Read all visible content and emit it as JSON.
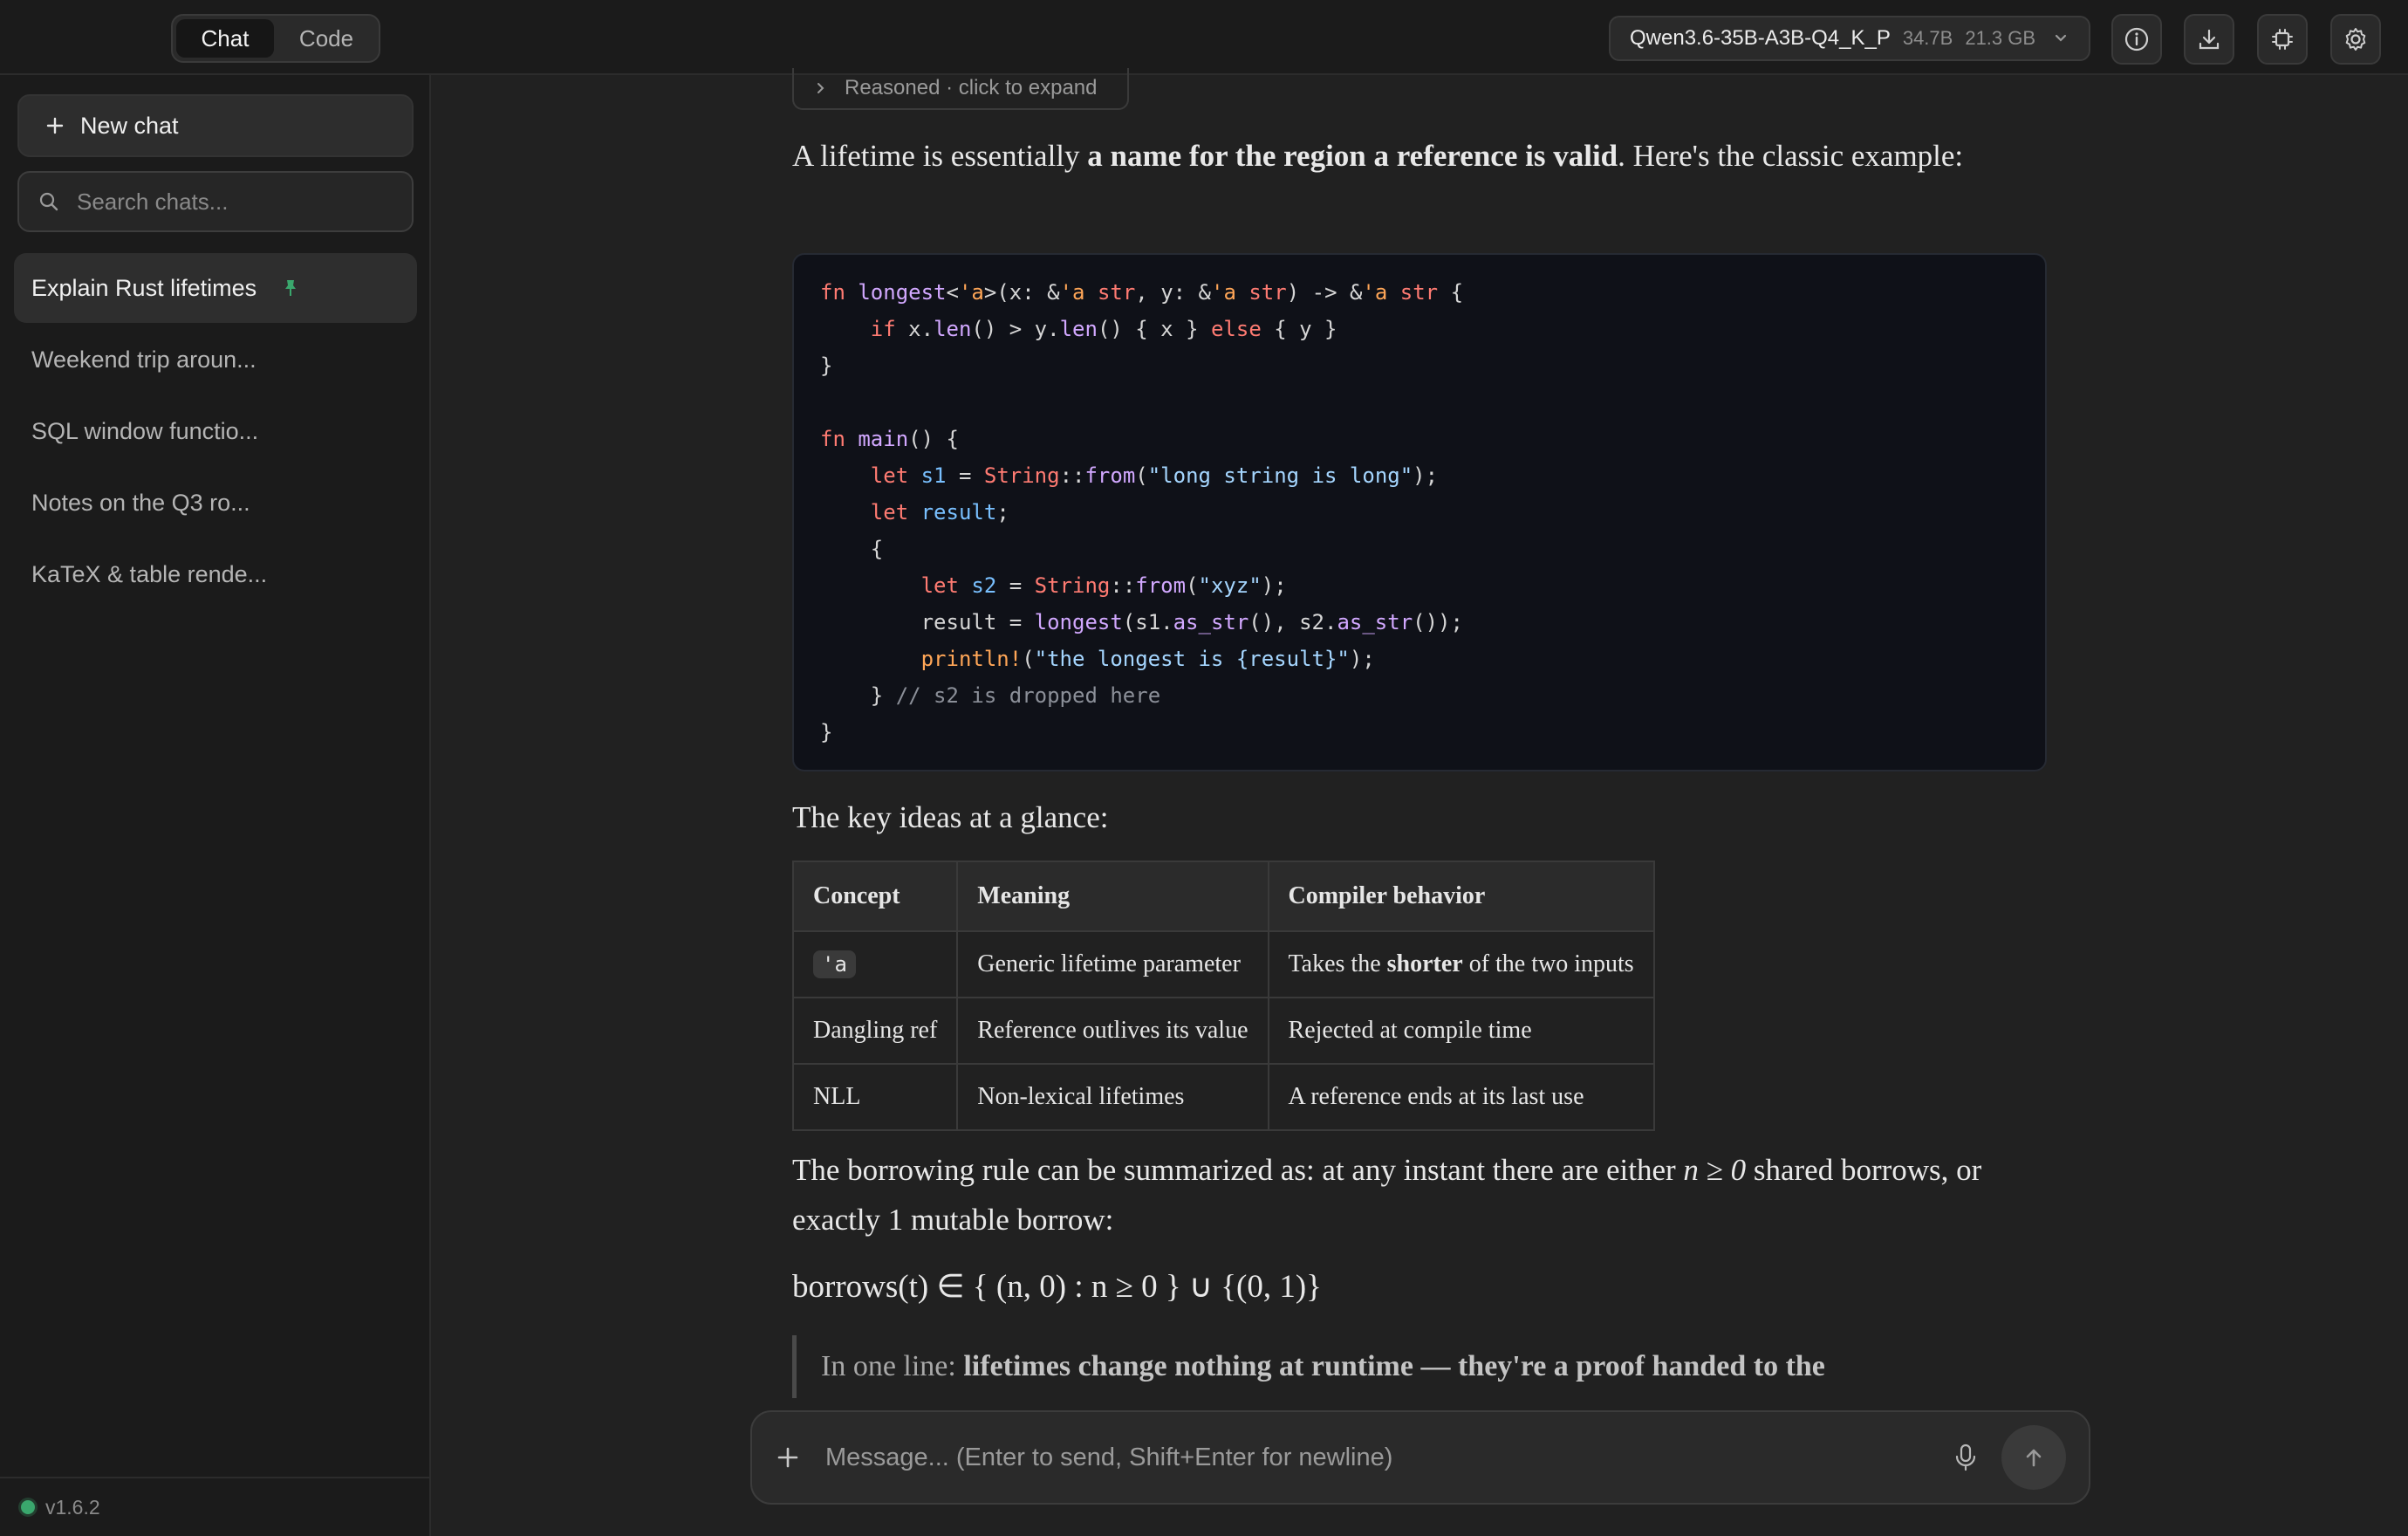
{
  "header": {
    "tabs": [
      {
        "label": "Chat",
        "active": true
      },
      {
        "label": "Code",
        "active": false
      }
    ],
    "model": {
      "name": "Qwen3.6-35B-A3B-Q4_K_P",
      "params": "34.7B",
      "size": "21.3 GB"
    },
    "icons": [
      "info-icon",
      "download-icon",
      "cpu-icon",
      "gear-icon"
    ]
  },
  "sidebar": {
    "new_chat_label": "New chat",
    "search_placeholder": "Search chats...",
    "chats": [
      {
        "title": "Explain Rust lifetimes",
        "active": true,
        "pinned": true
      },
      {
        "title": "Weekend trip aroun...",
        "active": false
      },
      {
        "title": "SQL window functio...",
        "active": false
      },
      {
        "title": "Notes on the Q3 ro...",
        "active": false
      },
      {
        "title": "KaTeX & table rende...",
        "active": false
      }
    ],
    "version": "v1.6.2",
    "status_color": "#3aa76d"
  },
  "message": {
    "reasoned_label": "Reasoned · click to expand",
    "intro_before": "A lifetime is essentially ",
    "intro_bold": "a name for the region a reference is valid",
    "intro_after": ". Here's the classic example:",
    "code_language": "rust",
    "key_ideas": "The key ideas at a glance:",
    "table": {
      "headers": [
        "Concept",
        "Meaning",
        "Compiler behavior"
      ],
      "rows": [
        {
          "concept": "'a",
          "meaning": "Generic lifetime parameter",
          "behavior_before": "Takes the ",
          "behavior_bold": "shorter",
          "behavior_after": " of the two inputs"
        },
        {
          "concept": "Dangling ref",
          "meaning": "Reference outlives its value",
          "behavior": "Rejected at compile time"
        },
        {
          "concept": "NLL",
          "meaning": "Non-lexical lifetimes",
          "behavior": "A reference ends at its last use"
        }
      ]
    },
    "rule_before": "The borrowing rule can be summarized as: at any instant there are either ",
    "rule_math": "n ≥ 0",
    "rule_after": " shared borrows, or exactly 1 mutable borrow:",
    "formula": "borrows(t) ∈ { (n, 0) : n ≥ 0 } ∪ {(0, 1)}",
    "quote_prefix": "In one line: ",
    "quote_bold": "lifetimes change nothing at runtime — they're a proof handed to the"
  },
  "composer": {
    "placeholder": "Message... (Enter to send, Shift+Enter for newline)"
  }
}
